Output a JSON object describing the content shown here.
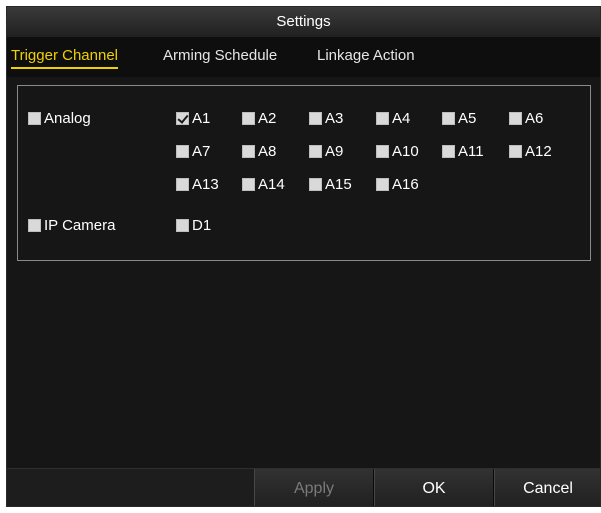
{
  "window": {
    "title": "Settings"
  },
  "tabs": [
    {
      "label": "Trigger Channel",
      "active": true
    },
    {
      "label": "Arming Schedule",
      "active": false
    },
    {
      "label": "Linkage Action",
      "active": false
    }
  ],
  "analog": {
    "label": "Analog",
    "checked": false,
    "channels": [
      {
        "label": "A1",
        "checked": true
      },
      {
        "label": "A2",
        "checked": false
      },
      {
        "label": "A3",
        "checked": false
      },
      {
        "label": "A4",
        "checked": false
      },
      {
        "label": "A5",
        "checked": false
      },
      {
        "label": "A6",
        "checked": false
      },
      {
        "label": "A7",
        "checked": false
      },
      {
        "label": "A8",
        "checked": false
      },
      {
        "label": "A9",
        "checked": false
      },
      {
        "label": "A10",
        "checked": false
      },
      {
        "label": "A11",
        "checked": false
      },
      {
        "label": "A12",
        "checked": false
      },
      {
        "label": "A13",
        "checked": false
      },
      {
        "label": "A14",
        "checked": false
      },
      {
        "label": "A15",
        "checked": false
      },
      {
        "label": "A16",
        "checked": false
      }
    ]
  },
  "ip_camera": {
    "label": "IP Camera",
    "checked": false,
    "channels": [
      {
        "label": "D1",
        "checked": false
      }
    ]
  },
  "buttons": {
    "apply": {
      "label": "Apply",
      "enabled": false
    },
    "ok": {
      "label": "OK",
      "enabled": true
    },
    "cancel": {
      "label": "Cancel",
      "enabled": true
    }
  },
  "colors": {
    "active_tab": "#f0d000",
    "background": "#161616",
    "text": "#ffffff"
  }
}
